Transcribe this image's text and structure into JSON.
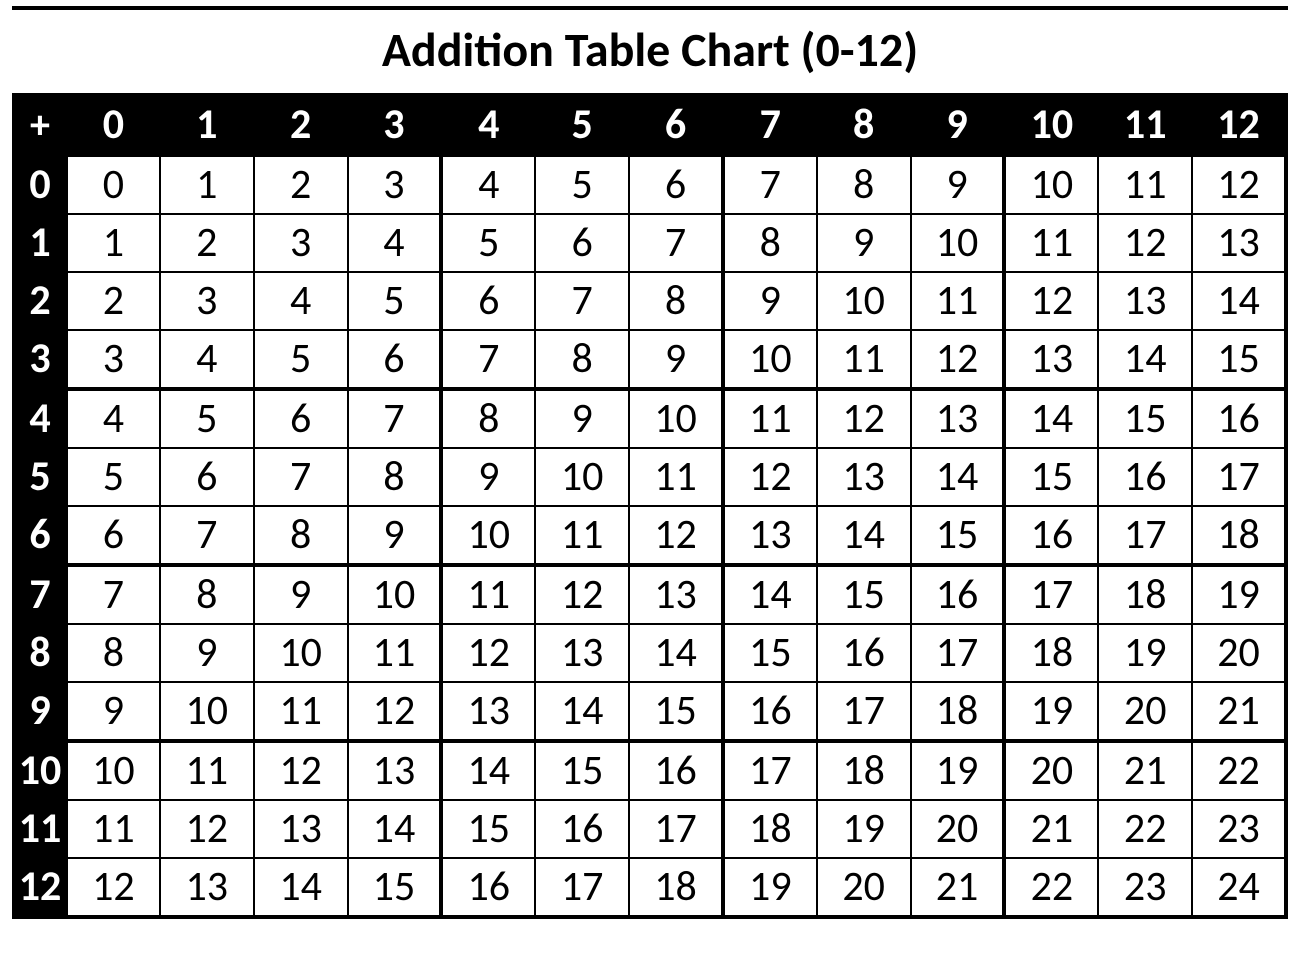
{
  "title": "Addition Table Chart (0-12)",
  "corner_symbol": "+",
  "col_headers": [
    "0",
    "1",
    "2",
    "3",
    "4",
    "5",
    "6",
    "7",
    "8",
    "9",
    "10",
    "11",
    "12"
  ],
  "row_headers": [
    "0",
    "1",
    "2",
    "3",
    "4",
    "5",
    "6",
    "7",
    "8",
    "9",
    "10",
    "11",
    "12"
  ],
  "cells": [
    [
      "0",
      "1",
      "2",
      "3",
      "4",
      "5",
      "6",
      "7",
      "8",
      "9",
      "10",
      "11",
      "12"
    ],
    [
      "1",
      "2",
      "3",
      "4",
      "5",
      "6",
      "7",
      "8",
      "9",
      "10",
      "11",
      "12",
      "13"
    ],
    [
      "2",
      "3",
      "4",
      "5",
      "6",
      "7",
      "8",
      "9",
      "10",
      "11",
      "12",
      "13",
      "14"
    ],
    [
      "3",
      "4",
      "5",
      "6",
      "7",
      "8",
      "9",
      "10",
      "11",
      "12",
      "13",
      "14",
      "15"
    ],
    [
      "4",
      "5",
      "6",
      "7",
      "8",
      "9",
      "10",
      "11",
      "12",
      "13",
      "14",
      "15",
      "16"
    ],
    [
      "5",
      "6",
      "7",
      "8",
      "9",
      "10",
      "11",
      "12",
      "13",
      "14",
      "15",
      "16",
      "17"
    ],
    [
      "6",
      "7",
      "8",
      "9",
      "10",
      "11",
      "12",
      "13",
      "14",
      "15",
      "16",
      "17",
      "18"
    ],
    [
      "7",
      "8",
      "9",
      "10",
      "11",
      "12",
      "13",
      "14",
      "15",
      "16",
      "17",
      "18",
      "19"
    ],
    [
      "8",
      "9",
      "10",
      "11",
      "12",
      "13",
      "14",
      "15",
      "16",
      "17",
      "18",
      "19",
      "20"
    ],
    [
      "9",
      "10",
      "11",
      "12",
      "13",
      "14",
      "15",
      "16",
      "17",
      "18",
      "19",
      "20",
      "21"
    ],
    [
      "10",
      "11",
      "12",
      "13",
      "14",
      "15",
      "16",
      "17",
      "18",
      "19",
      "20",
      "21",
      "22"
    ],
    [
      "11",
      "12",
      "13",
      "14",
      "15",
      "16",
      "17",
      "18",
      "19",
      "20",
      "21",
      "22",
      "23"
    ],
    [
      "12",
      "13",
      "14",
      "15",
      "16",
      "17",
      "18",
      "19",
      "20",
      "21",
      "22",
      "23",
      "24"
    ]
  ],
  "chart_data": {
    "type": "table",
    "title": "Addition Table Chart (0-12)",
    "operation": "addition",
    "x": [
      0,
      1,
      2,
      3,
      4,
      5,
      6,
      7,
      8,
      9,
      10,
      11,
      12
    ],
    "y": [
      0,
      1,
      2,
      3,
      4,
      5,
      6,
      7,
      8,
      9,
      10,
      11,
      12
    ],
    "values": [
      [
        0,
        1,
        2,
        3,
        4,
        5,
        6,
        7,
        8,
        9,
        10,
        11,
        12
      ],
      [
        1,
        2,
        3,
        4,
        5,
        6,
        7,
        8,
        9,
        10,
        11,
        12,
        13
      ],
      [
        2,
        3,
        4,
        5,
        6,
        7,
        8,
        9,
        10,
        11,
        12,
        13,
        14
      ],
      [
        3,
        4,
        5,
        6,
        7,
        8,
        9,
        10,
        11,
        12,
        13,
        14,
        15
      ],
      [
        4,
        5,
        6,
        7,
        8,
        9,
        10,
        11,
        12,
        13,
        14,
        15,
        16
      ],
      [
        5,
        6,
        7,
        8,
        9,
        10,
        11,
        12,
        13,
        14,
        15,
        16,
        17
      ],
      [
        6,
        7,
        8,
        9,
        10,
        11,
        12,
        13,
        14,
        15,
        16,
        17,
        18
      ],
      [
        7,
        8,
        9,
        10,
        11,
        12,
        13,
        14,
        15,
        16,
        17,
        18,
        19
      ],
      [
        8,
        9,
        10,
        11,
        12,
        13,
        14,
        15,
        16,
        17,
        18,
        19,
        20
      ],
      [
        9,
        10,
        11,
        12,
        13,
        14,
        15,
        16,
        17,
        18,
        19,
        20,
        21
      ],
      [
        10,
        11,
        12,
        13,
        14,
        15,
        16,
        17,
        18,
        19,
        20,
        21,
        22
      ],
      [
        11,
        12,
        13,
        14,
        15,
        16,
        17,
        18,
        19,
        20,
        21,
        22,
        23
      ],
      [
        12,
        13,
        14,
        15,
        16,
        17,
        18,
        19,
        20,
        21,
        22,
        23,
        24
      ]
    ]
  }
}
